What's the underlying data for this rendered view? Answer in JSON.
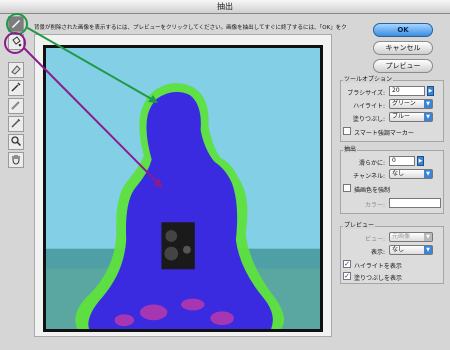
{
  "window": {
    "title": "抽出"
  },
  "instruction": "背景が削除された画像を表示するには、プレビューをクリックしてください。画像を抽出してすぐに終了するには、「OK」をクリックしてください。",
  "buttons": {
    "ok": "OK",
    "cancel": "キャンセル",
    "preview": "プレビュー"
  },
  "tool_options": {
    "title": "ツールオプション",
    "brush_size_label": "ブラシサイズ:",
    "brush_size_value": "20",
    "highlight_label": "ハイライト:",
    "highlight_value": "グリーン",
    "fill_label": "塗りつぶし:",
    "fill_value": "ブルー",
    "smart_highlight_label": "スマート強調マーカー"
  },
  "extraction": {
    "title": "抽出",
    "smooth_label": "滑らかに:",
    "smooth_value": "0",
    "channel_label": "チャンネル:",
    "channel_value": "なし",
    "force_fg_label": "描画色を強制",
    "color_label": "カラー:"
  },
  "preview": {
    "title": "プレビュー",
    "view_label": "ビュー:",
    "view_value": "元画像",
    "display_label": "表示:",
    "display_value": "なし",
    "show_highlight_label": "ハイライトを表示",
    "show_fill_label": "塗りつぶしを表示"
  },
  "colors": {
    "highlight": "#3fd13c",
    "fill": "#3a2be0",
    "annotation_green": "#1f9a45",
    "annotation_purple": "#8b1c8f",
    "sky": "#7dcfe8"
  }
}
